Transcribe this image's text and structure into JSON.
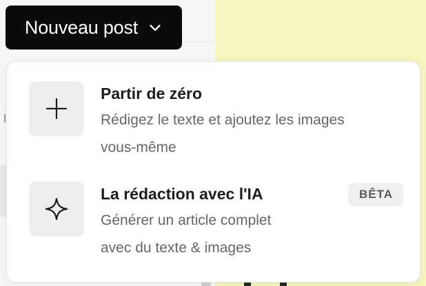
{
  "trigger": {
    "label": "Nouveau post",
    "chevron_icon": "chevron-down-icon"
  },
  "menu": {
    "items": [
      {
        "icon": "plus-icon",
        "title": "Partir de zéro",
        "desc_line1": "Rédigez le texte et ajoutez les images",
        "desc_line2": "vous-même"
      },
      {
        "icon": "sparkle-icon",
        "title": "La rédaction avec l'IA",
        "badge": "BÊTA",
        "desc_line1": "Générer un article complet",
        "desc_line2": "avec du texte & images"
      }
    ]
  },
  "colors": {
    "trigger_bg": "#0b0b0c",
    "backdrop_right": "#f6f4bf",
    "icon_tile": "#eeeeef",
    "badge_bg": "#efefef"
  }
}
